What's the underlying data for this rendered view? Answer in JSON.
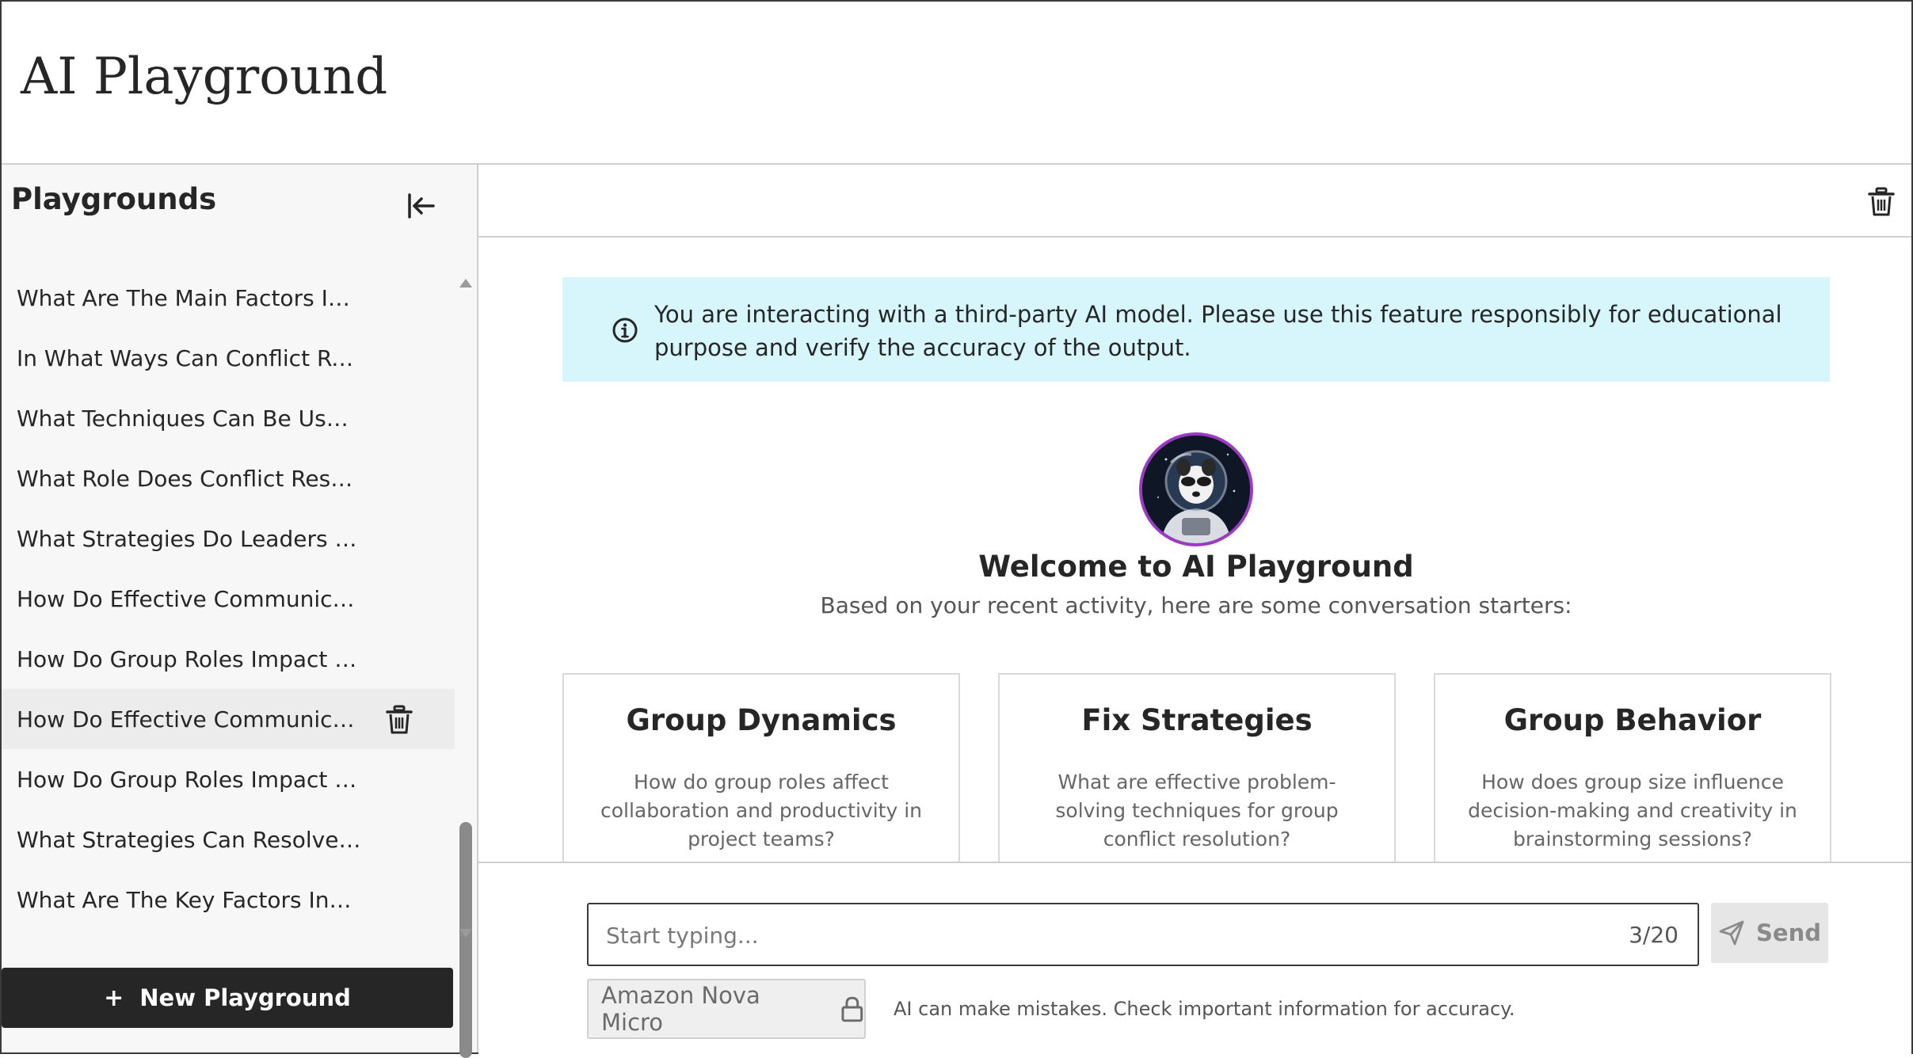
{
  "header": {
    "title": "AI Playground"
  },
  "sidebar": {
    "title": "Playgrounds",
    "items": [
      {
        "label": "What Are The Main Factors In..."
      },
      {
        "label": "In What Ways Can Conflict Res..."
      },
      {
        "label": "What Techniques Can Be Used..."
      },
      {
        "label": "What Role Does Conflict Resol..."
      },
      {
        "label": "What Strategies Do Leaders U..."
      },
      {
        "label": "How Do Effective Communicat..."
      },
      {
        "label": "How Do Group Roles Impact P..."
      },
      {
        "label": "How Do Effective Communicat..."
      },
      {
        "label": "How Do Group Roles Impact P..."
      },
      {
        "label": "What Strategies Can Resolve C..."
      },
      {
        "label": "What Are The Key Factors Infl..."
      }
    ],
    "new_button_label": "New Playground",
    "icons": {
      "collapse": "collapse-sidebar-icon",
      "item_delete": "trash-icon"
    }
  },
  "main": {
    "info_banner": {
      "icon": "info-icon",
      "text": "You are interacting with a third-party AI model. Please use this feature responsibly for educational purpose and verify the accuracy of the output."
    },
    "welcome_title": "Welcome to AI Playground",
    "welcome_subtitle": "Based on your recent activity, here are some conversation starters:",
    "cards": [
      {
        "title": "Group Dynamics",
        "description": "How do group roles affect collaboration and productivity in project teams?"
      },
      {
        "title": "Fix Strategies",
        "description": "What are effective problem-solving techniques for group conflict resolution?"
      },
      {
        "title": "Group Behavior",
        "description": "How does group size influence decision-making and creativity in brainstorming sessions?"
      }
    ],
    "composer": {
      "placeholder": "Start typing...",
      "counter": "3/20",
      "send_label": "Send",
      "model_label": "Amazon Nova Micro",
      "disclaimer": "AI can make mistakes. Check important information for accuracy."
    }
  },
  "colors": {
    "banner_bg": "#d6f6fb",
    "avatar_ring": "#9b3bc4",
    "new_button_bg": "#262626",
    "sidebar_bg": "#f7f7f7"
  }
}
